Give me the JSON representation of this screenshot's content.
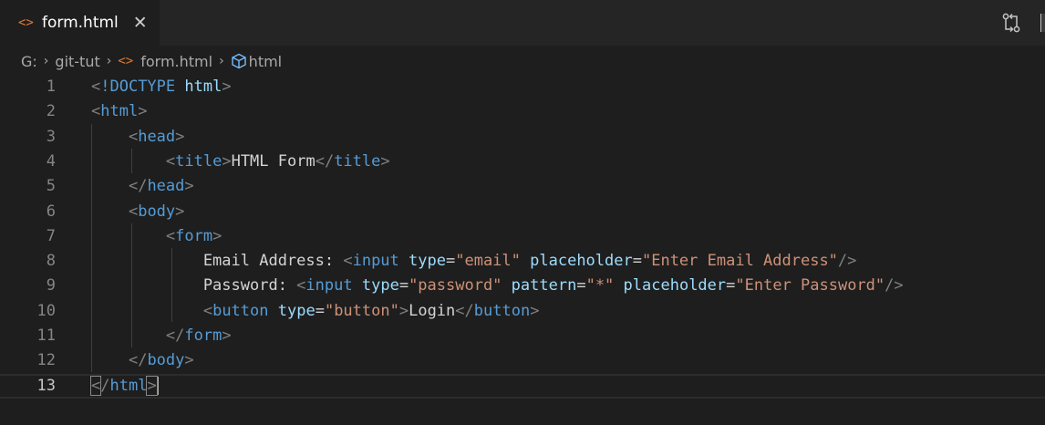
{
  "tab": {
    "icon": "<>",
    "title": "form.html",
    "close": "✕",
    "icon_name": "html-file-icon",
    "close_icon_name": "close-icon"
  },
  "toolbar": {
    "compare_icon_name": "open-changes-icon"
  },
  "breadcrumb": {
    "drive": "G:",
    "folder": "git-tut",
    "file": "form.html",
    "symbol": "html",
    "file_icon": "<>",
    "separator": "›"
  },
  "editor": {
    "current_line": 13,
    "lines": [
      {
        "n": "1",
        "tokens": [
          [
            "p",
            "<"
          ],
          [
            "d",
            "!DOCTYPE"
          ],
          [
            "t",
            " "
          ],
          [
            "da",
            "html"
          ],
          [
            "p",
            ">"
          ]
        ]
      },
      {
        "n": "2",
        "tokens": [
          [
            "p",
            "<"
          ],
          [
            "g",
            "html"
          ],
          [
            "p",
            ">"
          ]
        ]
      },
      {
        "n": "3",
        "tokens": [
          [
            "t",
            "    "
          ],
          [
            "p",
            "<"
          ],
          [
            "g",
            "head"
          ],
          [
            "p",
            ">"
          ]
        ]
      },
      {
        "n": "4",
        "tokens": [
          [
            "t",
            "        "
          ],
          [
            "p",
            "<"
          ],
          [
            "g",
            "title"
          ],
          [
            "p",
            ">"
          ],
          [
            "t",
            "HTML Form"
          ],
          [
            "p",
            "</"
          ],
          [
            "g",
            "title"
          ],
          [
            "p",
            ">"
          ]
        ]
      },
      {
        "n": "5",
        "tokens": [
          [
            "t",
            "    "
          ],
          [
            "p",
            "</"
          ],
          [
            "g",
            "head"
          ],
          [
            "p",
            ">"
          ]
        ]
      },
      {
        "n": "6",
        "tokens": [
          [
            "t",
            "    "
          ],
          [
            "p",
            "<"
          ],
          [
            "g",
            "body"
          ],
          [
            "p",
            ">"
          ]
        ]
      },
      {
        "n": "7",
        "tokens": [
          [
            "t",
            "        "
          ],
          [
            "p",
            "<"
          ],
          [
            "g",
            "form"
          ],
          [
            "p",
            ">"
          ]
        ]
      },
      {
        "n": "8",
        "tokens": [
          [
            "t",
            "            Email Address: "
          ],
          [
            "p",
            "<"
          ],
          [
            "g",
            "input"
          ],
          [
            "t",
            " "
          ],
          [
            "a",
            "type"
          ],
          [
            "t",
            "="
          ],
          [
            "s",
            "\"email\""
          ],
          [
            "t",
            " "
          ],
          [
            "a",
            "placeholder"
          ],
          [
            "t",
            "="
          ],
          [
            "s",
            "\"Enter Email Address\""
          ],
          [
            "p",
            "/>"
          ]
        ]
      },
      {
        "n": "9",
        "tokens": [
          [
            "t",
            "            Password: "
          ],
          [
            "p",
            "<"
          ],
          [
            "g",
            "input"
          ],
          [
            "t",
            " "
          ],
          [
            "a",
            "type"
          ],
          [
            "t",
            "="
          ],
          [
            "s",
            "\"password\""
          ],
          [
            "t",
            " "
          ],
          [
            "a",
            "pattern"
          ],
          [
            "t",
            "="
          ],
          [
            "s",
            "\"*\""
          ],
          [
            "t",
            " "
          ],
          [
            "a",
            "placeholder"
          ],
          [
            "t",
            "="
          ],
          [
            "s",
            "\"Enter Password\""
          ],
          [
            "p",
            "/>"
          ]
        ]
      },
      {
        "n": "10",
        "tokens": [
          [
            "t",
            "            "
          ],
          [
            "p",
            "<"
          ],
          [
            "g",
            "button"
          ],
          [
            "t",
            " "
          ],
          [
            "a",
            "type"
          ],
          [
            "t",
            "="
          ],
          [
            "s",
            "\"button\""
          ],
          [
            "p",
            ">"
          ],
          [
            "t",
            "Login"
          ],
          [
            "p",
            "</"
          ],
          [
            "g",
            "button"
          ],
          [
            "p",
            ">"
          ]
        ]
      },
      {
        "n": "11",
        "tokens": [
          [
            "t",
            "        "
          ],
          [
            "p",
            "</"
          ],
          [
            "g",
            "form"
          ],
          [
            "p",
            ">"
          ]
        ]
      },
      {
        "n": "12",
        "tokens": [
          [
            "t",
            "    "
          ],
          [
            "p",
            "</"
          ],
          [
            "g",
            "body"
          ],
          [
            "p",
            ">"
          ]
        ]
      },
      {
        "n": "13",
        "tokens": [
          [
            "pm",
            "<"
          ],
          [
            "p",
            "/"
          ],
          [
            "g",
            "html"
          ],
          [
            "pm",
            ">"
          ],
          [
            "c",
            ""
          ]
        ]
      }
    ]
  }
}
